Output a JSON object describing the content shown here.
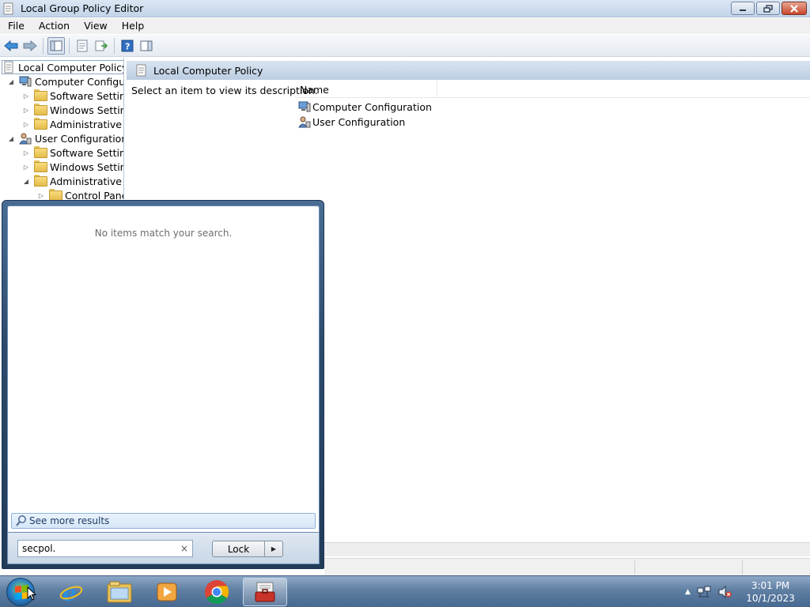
{
  "window": {
    "title": "Local Group Policy Editor",
    "menu": [
      "File",
      "Action",
      "View",
      "Help"
    ]
  },
  "tree": {
    "root": "Local Computer Policy",
    "items": [
      {
        "label": "Computer Configura",
        "depth": 1,
        "expanded": true,
        "icon": "computer-config-icon"
      },
      {
        "label": "Software Settings",
        "depth": 2,
        "expanded": false,
        "icon": "folder-icon"
      },
      {
        "label": "Windows Setting",
        "depth": 2,
        "expanded": false,
        "icon": "folder-icon"
      },
      {
        "label": "Administrative Te",
        "depth": 2,
        "expanded": false,
        "icon": "folder-icon"
      },
      {
        "label": "User Configuration",
        "depth": 1,
        "expanded": true,
        "icon": "user-config-icon"
      },
      {
        "label": "Software Settings",
        "depth": 2,
        "expanded": false,
        "icon": "folder-icon"
      },
      {
        "label": "Windows Setting",
        "depth": 2,
        "expanded": false,
        "icon": "folder-icon"
      },
      {
        "label": "Administrative Te",
        "depth": 2,
        "expanded": true,
        "icon": "folder-icon"
      },
      {
        "label": "Control Panel",
        "depth": 3,
        "expanded": false,
        "icon": "folder-icon"
      }
    ]
  },
  "main": {
    "header": "Local Computer Policy",
    "description": "Select an item to view its description.",
    "column_name": "Name",
    "rows": [
      {
        "label": "Computer Configuration",
        "icon": "computer-config-icon"
      },
      {
        "label": "User Configuration",
        "icon": "user-config-icon"
      }
    ]
  },
  "start_menu": {
    "empty_message": "No items match your search.",
    "see_more": "See more results",
    "search_value": "secpol.",
    "clear": "×",
    "power_button": "Lock"
  },
  "taskbar": {
    "apps": [
      "start-orb",
      "internet-explorer-icon",
      "file-explorer-icon",
      "media-player-icon",
      "chrome-icon",
      "group-policy-editor-icon"
    ],
    "time": "3:01 PM",
    "date": "10/1/2023"
  }
}
